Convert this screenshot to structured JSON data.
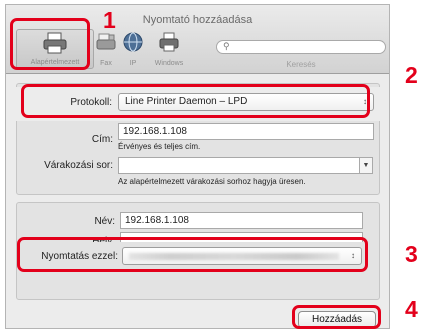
{
  "window": {
    "title": "Nyomtató hozzáadása"
  },
  "toolbar": {
    "default_label": "Alapértelmezett",
    "fax_label": "Fax",
    "ip_label": "IP",
    "windows_label": "Windows",
    "search_placeholder": "",
    "search_caption": "Keresés"
  },
  "protocol": {
    "label": "Protokoll:",
    "value": "Line Printer Daemon – LPD"
  },
  "address": {
    "label": "Cím:",
    "value": "192.168.1.108",
    "hint": "Érvényes és teljes cím."
  },
  "queue": {
    "label": "Várakozási sor:",
    "value": "",
    "hint": "Az alapértelmezett várakozási sorhoz hagyja üresen."
  },
  "name": {
    "label": "Név:",
    "value": "192.168.1.108"
  },
  "location": {
    "label": "Hely:",
    "value": ""
  },
  "print_using": {
    "label": "Nyomtatás ezzel:",
    "value": ""
  },
  "actions": {
    "add_label": "Hozzáadás"
  },
  "callouts": {
    "n1": "1",
    "n2": "2",
    "n3": "3",
    "n4": "4"
  },
  "colors": {
    "callout": "#e3001b",
    "window_bg": "#ececec"
  },
  "icons": [
    "printer-icon",
    "fax-icon",
    "ip-globe-icon",
    "windows-printer-icon",
    "search-icon"
  ]
}
